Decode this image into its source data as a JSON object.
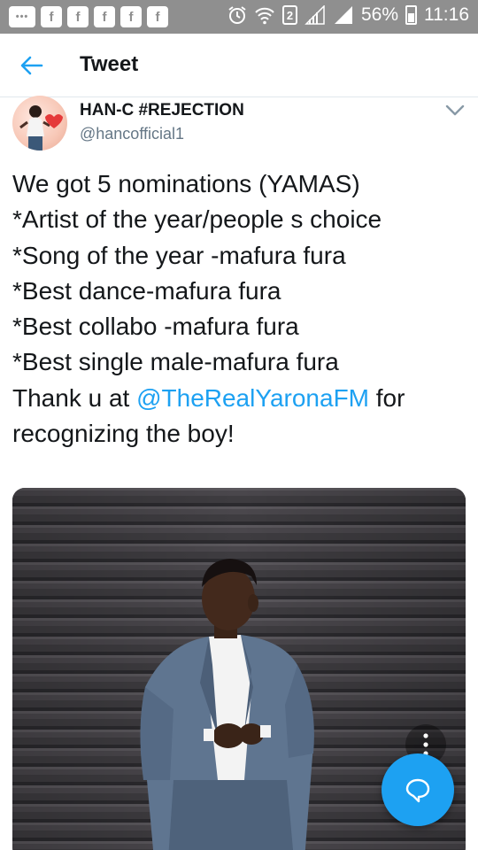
{
  "status_bar": {
    "app_icons": [
      "msg-icon",
      "facebook-icon",
      "facebook-icon",
      "facebook-icon",
      "facebook-icon",
      "facebook-icon"
    ],
    "sim": "2",
    "battery": "56%",
    "time": "11:16"
  },
  "header": {
    "title": "Tweet"
  },
  "author": {
    "name": "HAN-C #REJECTION",
    "handle": "@hancofficial1"
  },
  "tweet": {
    "lines": [
      "We got 5 nominations (YAMAS)",
      "*Artist of the year/people s choice",
      "*Song of the year -mafura fura",
      "*Best dance-mafura fura",
      "*Best collabo -mafura fura",
      "*Best single male-mafura fura"
    ],
    "thanks_prefix": "Thank u at ",
    "mention": "@TheRealYaronaFM",
    "thanks_suffix": " for",
    "last_line": "recognizing the boy!"
  },
  "colors": {
    "accent": "#1da1f2",
    "status_bar": "#8f8f8f",
    "text": "#14171a",
    "secondary_text": "#657786"
  }
}
